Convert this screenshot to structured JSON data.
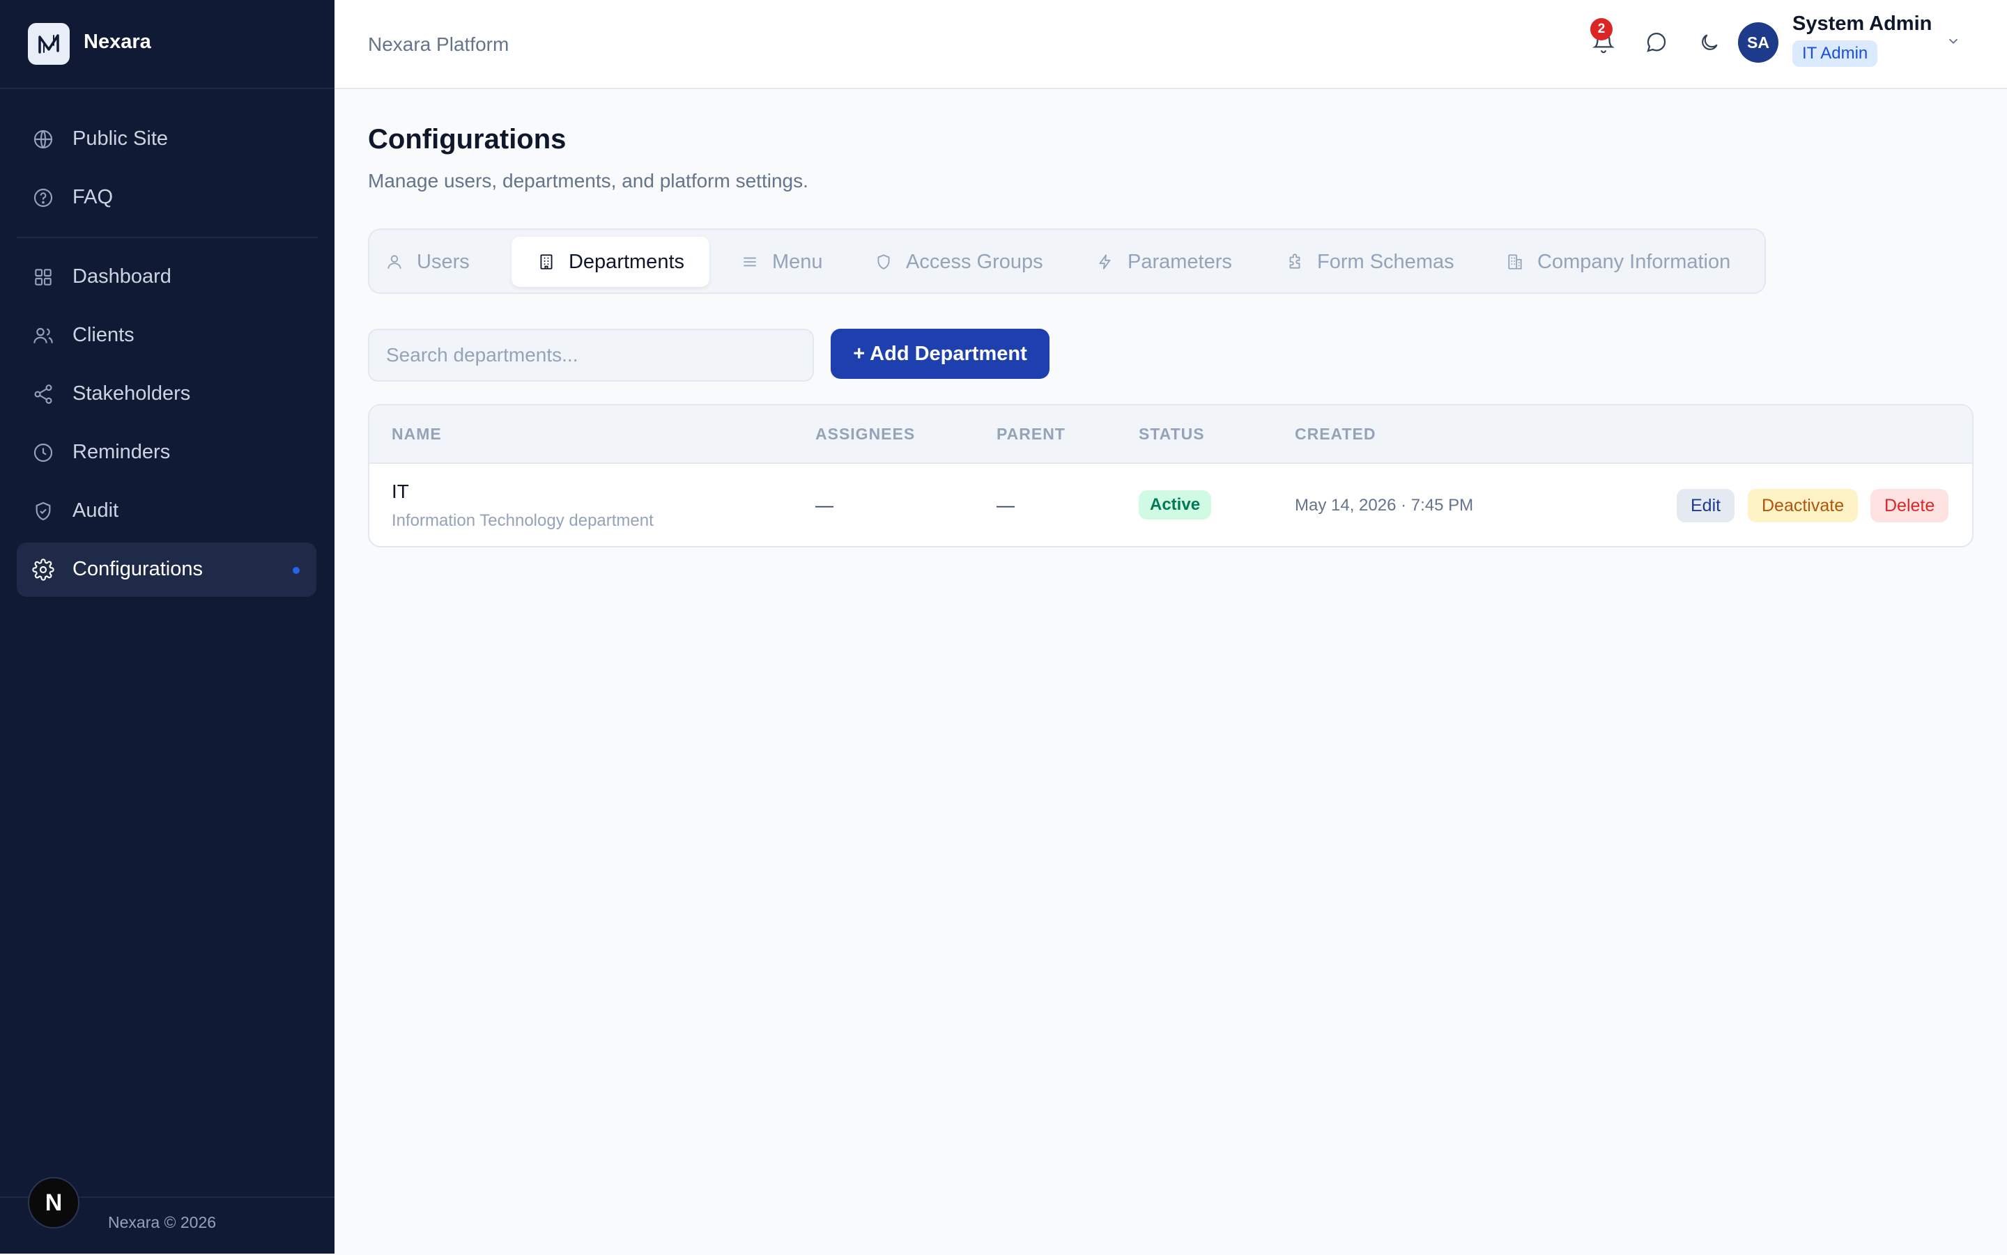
{
  "brand": {
    "name": "Nexara"
  },
  "sidebar": {
    "top_items": [
      {
        "label": "Public Site",
        "icon": "globe-icon"
      },
      {
        "label": "FAQ",
        "icon": "help-circle-icon"
      }
    ],
    "items": [
      {
        "label": "Dashboard",
        "icon": "grid-icon"
      },
      {
        "label": "Clients",
        "icon": "users-icon"
      },
      {
        "label": "Stakeholders",
        "icon": "share-icon"
      },
      {
        "label": "Reminders",
        "icon": "clock-icon"
      },
      {
        "label": "Audit",
        "icon": "shield-check-icon"
      },
      {
        "label": "Configurations",
        "icon": "gear-icon",
        "active": true
      }
    ],
    "footer": {
      "badge": "N",
      "copyright": "Nexara © 2026"
    }
  },
  "topbar": {
    "platform": "Nexara Platform",
    "notification_count": "2",
    "user": {
      "initials": "SA",
      "name": "System Admin",
      "role": "IT Admin"
    }
  },
  "page": {
    "title": "Configurations",
    "subtitle": "Manage users, departments, and platform settings."
  },
  "tabs": [
    {
      "label": "Users",
      "icon": "user-icon"
    },
    {
      "label": "Departments",
      "icon": "building-icon",
      "active": true
    },
    {
      "label": "Menu",
      "icon": "menu-icon"
    },
    {
      "label": "Access Groups",
      "icon": "shield-icon"
    },
    {
      "label": "Parameters",
      "icon": "bolt-icon"
    },
    {
      "label": "Form Schemas",
      "icon": "puzzle-icon"
    },
    {
      "label": "Company Information",
      "icon": "office-icon"
    }
  ],
  "toolbar": {
    "search_placeholder": "Search departments...",
    "add_label": "+ Add Department"
  },
  "table": {
    "columns": [
      "NAME",
      "ASSIGNEES",
      "PARENT",
      "STATUS",
      "CREATED"
    ],
    "rows": [
      {
        "name": "IT",
        "description": "Information Technology department",
        "assignees": "—",
        "parent": "—",
        "status": "Active",
        "created": "May 14, 2026 · 7:45 PM",
        "actions": {
          "edit": "Edit",
          "deactivate": "Deactivate",
          "delete": "Delete"
        }
      }
    ]
  },
  "colors": {
    "sidebar_bg": "#101a35",
    "accent": "#1e40af",
    "active_status": "#047857",
    "danger": "#dc2626",
    "warning": "#b45309"
  }
}
